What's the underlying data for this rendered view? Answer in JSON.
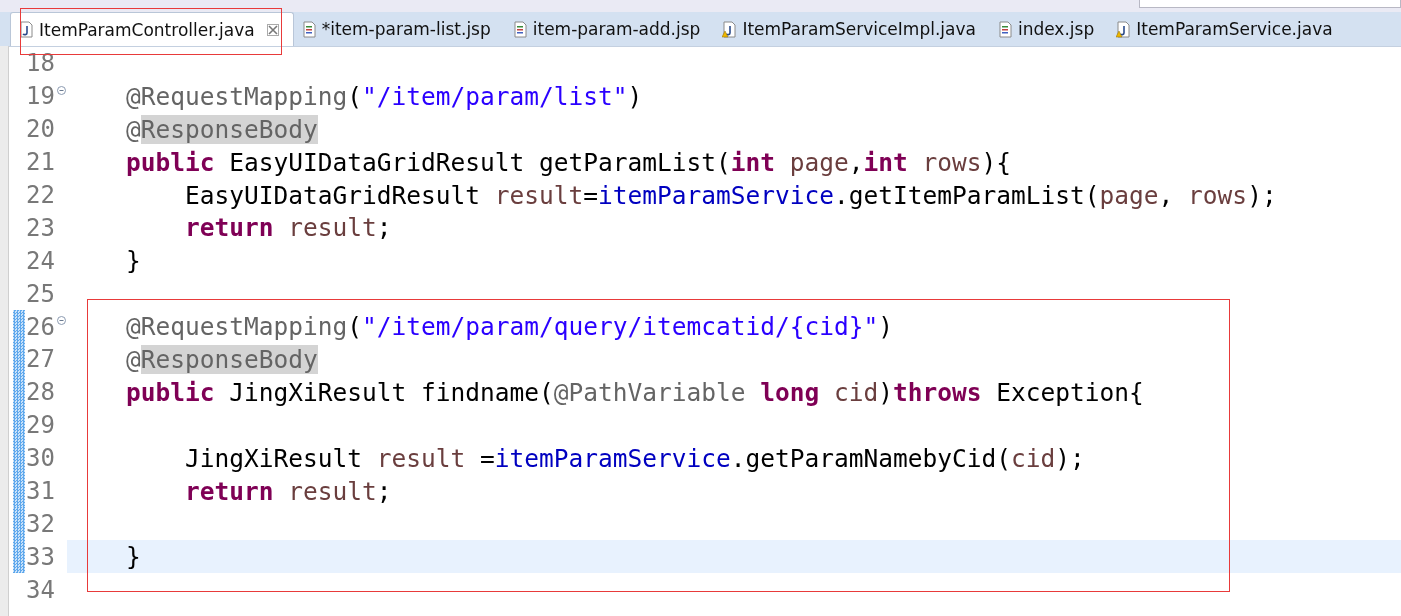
{
  "tabs": [
    {
      "label": "ItemParamController.java",
      "kind": "java",
      "warning": false,
      "selected": true
    },
    {
      "label": "*item-param-list.jsp",
      "kind": "jsp",
      "warning": false,
      "selected": false
    },
    {
      "label": "item-param-add.jsp",
      "kind": "jsp",
      "warning": false,
      "selected": false
    },
    {
      "label": "ItemParamServiceImpl.java",
      "kind": "java",
      "warning": true,
      "selected": false
    },
    {
      "label": "index.jsp",
      "kind": "jsp",
      "warning": false,
      "selected": false
    },
    {
      "label": "ItemParamService.java",
      "kind": "java",
      "warning": true,
      "selected": false
    }
  ],
  "lines": [
    {
      "number": "18",
      "foldable": false,
      "changed": false,
      "current": false
    },
    {
      "number": "19",
      "foldable": true,
      "changed": false,
      "current": false,
      "tokens": [
        {
          "kind": "annotation",
          "t": "    @RequestMapping"
        },
        {
          "kind": "plain",
          "t": "("
        },
        {
          "kind": "string",
          "t": "\"/item/param/list\""
        },
        {
          "kind": "plain",
          "t": ")"
        }
      ]
    },
    {
      "number": "20",
      "foldable": false,
      "changed": false,
      "current": false,
      "tokens": [
        {
          "kind": "annotation",
          "t": "    @"
        },
        {
          "kind": "annotation-marked",
          "t": "ResponseBody"
        }
      ]
    },
    {
      "number": "21",
      "foldable": false,
      "changed": false,
      "current": false,
      "tokens": [
        {
          "kind": "keyword",
          "t": "    public"
        },
        {
          "kind": "plain",
          "t": " EasyUIDataGridResult getParamList("
        },
        {
          "kind": "keyword",
          "t": "int"
        },
        {
          "kind": "variable",
          "t": " page"
        },
        {
          "kind": "plain",
          "t": ","
        },
        {
          "kind": "keyword",
          "t": "int"
        },
        {
          "kind": "variable",
          "t": " rows"
        },
        {
          "kind": "plain",
          "t": "){"
        }
      ]
    },
    {
      "number": "22",
      "foldable": false,
      "changed": false,
      "current": false,
      "tokens": [
        {
          "kind": "plain",
          "t": "        EasyUIDataGridResult "
        },
        {
          "kind": "variable",
          "t": "result"
        },
        {
          "kind": "plain",
          "t": "="
        },
        {
          "kind": "field",
          "t": "itemParamService"
        },
        {
          "kind": "plain",
          "t": ".getItemParamList("
        },
        {
          "kind": "variable",
          "t": "page"
        },
        {
          "kind": "plain",
          "t": ", "
        },
        {
          "kind": "variable",
          "t": "rows"
        },
        {
          "kind": "plain",
          "t": ");"
        }
      ]
    },
    {
      "number": "23",
      "foldable": false,
      "changed": false,
      "current": false,
      "tokens": [
        {
          "kind": "keyword",
          "t": "        return"
        },
        {
          "kind": "variable",
          "t": " result"
        },
        {
          "kind": "plain",
          "t": ";"
        }
      ]
    },
    {
      "number": "24",
      "foldable": false,
      "changed": false,
      "current": false,
      "tokens": [
        {
          "kind": "plain",
          "t": "    }"
        }
      ]
    },
    {
      "number": "25",
      "foldable": false,
      "changed": false,
      "current": false
    },
    {
      "number": "26",
      "foldable": true,
      "changed": true,
      "current": false,
      "tokens": [
        {
          "kind": "annotation",
          "t": "    @RequestMapping"
        },
        {
          "kind": "plain",
          "t": "("
        },
        {
          "kind": "string",
          "t": "\"/item/param/query/itemcatid/{cid}\""
        },
        {
          "kind": "plain",
          "t": ")"
        }
      ]
    },
    {
      "number": "27",
      "foldable": false,
      "changed": true,
      "current": false,
      "tokens": [
        {
          "kind": "annotation",
          "t": "    @"
        },
        {
          "kind": "annotation-marked",
          "t": "ResponseBody"
        }
      ]
    },
    {
      "number": "28",
      "foldable": false,
      "changed": true,
      "current": false,
      "tokens": [
        {
          "kind": "keyword",
          "t": "    public"
        },
        {
          "kind": "plain",
          "t": " JingXiResult findname("
        },
        {
          "kind": "annotation",
          "t": "@PathVariable"
        },
        {
          "kind": "keyword",
          "t": " long"
        },
        {
          "kind": "variable",
          "t": " cid"
        },
        {
          "kind": "plain",
          "t": ")"
        },
        {
          "kind": "keyword",
          "t": "throws"
        },
        {
          "kind": "plain",
          "t": " Exception{"
        }
      ]
    },
    {
      "number": "29",
      "foldable": false,
      "changed": true,
      "current": false
    },
    {
      "number": "30",
      "foldable": false,
      "changed": true,
      "current": false,
      "tokens": [
        {
          "kind": "plain",
          "t": "        JingXiResult "
        },
        {
          "kind": "variable",
          "t": "result"
        },
        {
          "kind": "plain",
          "t": " ="
        },
        {
          "kind": "field",
          "t": "itemParamService"
        },
        {
          "kind": "plain",
          "t": ".getParamNamebyCid("
        },
        {
          "kind": "variable",
          "t": "cid"
        },
        {
          "kind": "plain",
          "t": ");"
        }
      ]
    },
    {
      "number": "31",
      "foldable": false,
      "changed": true,
      "current": false,
      "tokens": [
        {
          "kind": "keyword",
          "t": "        return"
        },
        {
          "kind": "variable",
          "t": " result"
        },
        {
          "kind": "plain",
          "t": ";"
        }
      ]
    },
    {
      "number": "32",
      "foldable": false,
      "changed": true,
      "current": false
    },
    {
      "number": "33",
      "foldable": false,
      "changed": true,
      "current": true,
      "tokens": [
        {
          "kind": "plain",
          "t": "    }"
        }
      ]
    },
    {
      "number": "34",
      "foldable": false,
      "changed": false,
      "current": false
    }
  ]
}
